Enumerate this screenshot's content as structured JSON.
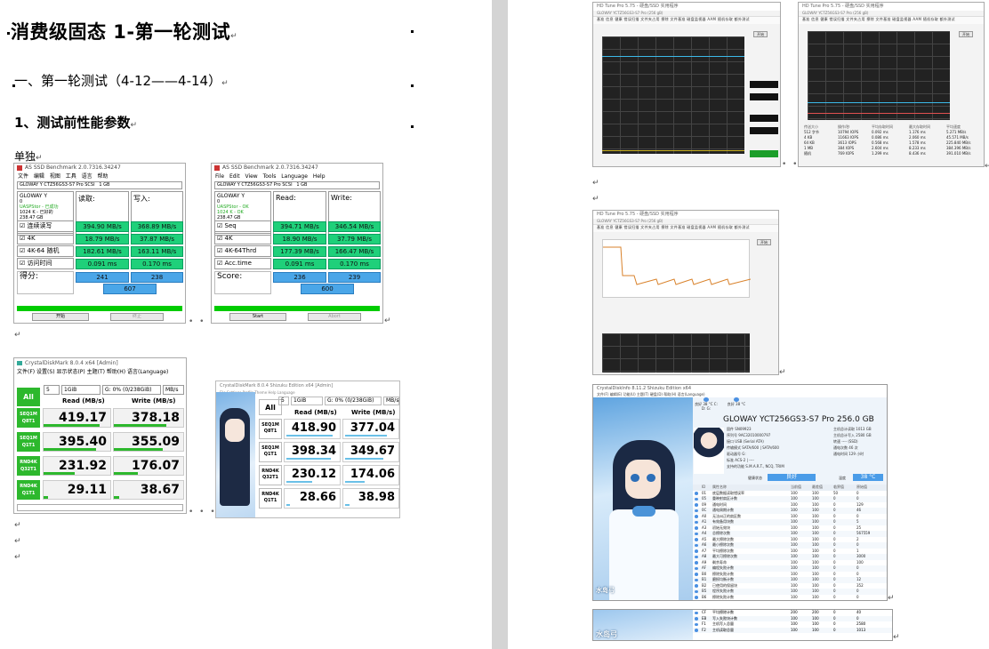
{
  "doc": {
    "title": "消费级固态 1-第一轮测试",
    "section": "一、第一轮测试（4-12——4-14）",
    "subsection": "1、测试前性能参数",
    "label_single": "单独",
    "para_mark": "↵"
  },
  "asssd_cn": {
    "titlebar": "AS SSD Benchmark 2.0.7316.34247",
    "menu": "文件  编辑  视图  工具  语言  帮助",
    "drive_select": "GLOWAY Y CTZ56GS3-S7 Pro SCSI",
    "size_select": "1 GB",
    "info": [
      "GLOWAY Y",
      "0",
      "UASPStor - 已成功",
      "1024 K - 已好的",
      "238.47 GB"
    ],
    "col_read": "读取:",
    "col_write": "写入:",
    "rows": [
      {
        "label": "连续读写",
        "read": "394.90 MB/s",
        "write": "368.89 MB/s"
      },
      {
        "label": "4K",
        "read": "18.79 MB/s",
        "write": "37.87 MB/s"
      },
      {
        "label": "4K-64 随机",
        "read": "182.61 MB/s",
        "write": "163.11 MB/s"
      },
      {
        "label": "访问时间",
        "read": "0.091 ms",
        "write": "0.170 ms"
      }
    ],
    "score_label": "得分:",
    "score_read": "241",
    "score_write": "238",
    "score_total": "607",
    "btn_start": "开始",
    "btn_abort": "终止"
  },
  "asssd_en": {
    "titlebar": "AS SSD Benchmark 2.0.7316.34247",
    "menu": "File  Edit  View  Tools  Language  Help",
    "drive_select": "GLOWAY Y CTZ56GS3-S7 Pro SCSI",
    "size_select": "1 GB",
    "info": [
      "GLOWAY Y",
      "0",
      "UASPStor - OK",
      "1024 K - OK",
      "238.47 GB"
    ],
    "col_read": "Read:",
    "col_write": "Write:",
    "rows": [
      {
        "label": "Seq",
        "read": "394.71 MB/s",
        "write": "346.54 MB/s"
      },
      {
        "label": "4K",
        "read": "18.90 MB/s",
        "write": "37.79 MB/s"
      },
      {
        "label": "4K-64Thrd",
        "read": "177.39 MB/s",
        "write": "166.47 MB/s"
      },
      {
        "label": "Acc.time",
        "read": "0.091 ms",
        "write": "0.170 ms"
      }
    ],
    "score_label": "Score:",
    "score_read": "236",
    "score_write": "239",
    "score_total": "600",
    "btn_start": "Start",
    "btn_abort": "Abort"
  },
  "cdm_cn": {
    "titlebar": "CrystalDiskMark 8.0.4 x64 [Admin]",
    "menu": "文件(F)  设置(S)  显示状态(P)  主题(T)  帮助(H)  语言(Language)",
    "all": "All",
    "count": "5",
    "size": "1GiB",
    "drive": "G: 0% (0/238GiB)",
    "unit": "MB/s",
    "head_read": "Read (MB/s)",
    "head_write": "Write (MB/s)",
    "rows": [
      {
        "l1": "SEQ1M",
        "l2": "Q8T1",
        "read": "419.17",
        "write": "378.18",
        "rf": 0.84,
        "wf": 0.76
      },
      {
        "l1": "SEQ1M",
        "l2": "Q1T1",
        "read": "395.40",
        "write": "355.09",
        "rf": 0.79,
        "wf": 0.71
      },
      {
        "l1": "RND4K",
        "l2": "Q32T1",
        "read": "231.92",
        "write": "176.07",
        "rf": 0.46,
        "wf": 0.35
      },
      {
        "l1": "RND4K",
        "l2": "Q1T1",
        "read": "29.11",
        "write": "38.67",
        "rf": 0.06,
        "wf": 0.08
      }
    ]
  },
  "cdm_shizuku": {
    "titlebar": "CrystalDiskMark 8.0.4 Shizuku Edition x64 [Admin]",
    "menu": "File  Settings  Profile  Theme  Help  Language",
    "all": "All",
    "count": "5",
    "size": "1GiB",
    "drive": "G: 0% (0/238GiB)",
    "unit": "MB/s",
    "head_read": "Read (MB/s)",
    "head_write": "Write (MB/s)",
    "rows": [
      {
        "l1": "SEQ1M",
        "l2": "Q8T1",
        "read": "418.90",
        "write": "377.04",
        "rf": 0.84,
        "wf": 0.75
      },
      {
        "l1": "SEQ1M",
        "l2": "Q1T1",
        "read": "398.34",
        "write": "349.67",
        "rf": 0.8,
        "wf": 0.7
      },
      {
        "l1": "RND4K",
        "l2": "Q32T1",
        "read": "230.12",
        "write": "174.06",
        "rf": 0.46,
        "wf": 0.35
      },
      {
        "l1": "RND4K",
        "l2": "Q1T1",
        "read": "28.66",
        "write": "38.98",
        "rf": 0.06,
        "wf": 0.08
      }
    ]
  },
  "hdtune": {
    "titlebar": "HD Tune Pro 5.75 - 硬盘/SSD 实用程序",
    "drive": "GLOWAY YCTZ56GS3-S7 Pro (256 gB)",
    "tabs": "基准  信息  健康  错误扫描  文件夹占用  擦除  文件基准  磁盘监视器  AAM  随机存取  额外测试",
    "start": "开始",
    "table_head": [
      "传送大小",
      "操作/秒",
      "平均存取时间",
      "最大存取时间",
      "平均速度"
    ],
    "table_rows": [
      [
        "512 字节",
        "10794 IOPS",
        "0.092 ms",
        "1.176 ms",
        "5.271 MB/s"
      ],
      [
        "4 KB",
        "11663 IOPS",
        "0.086 ms",
        "2.060 ms",
        "45.571 MB/s"
      ],
      [
        "64 KB",
        "3613 IOPS",
        "0.568 ms",
        "1.578 ms",
        "225.840 MB/s"
      ],
      [
        "1 MB",
        "384 IOPS",
        "2.604 ms",
        "8.233 ms",
        "384.396 MB/s"
      ],
      [
        "随机",
        "769 IOPS",
        "1.299 ms",
        "8.436 ms",
        "391.010 MB/s"
      ]
    ]
  },
  "cdi": {
    "titlebar": "CrystalDiskInfo 8.11.2 Shizuku Edition x64",
    "menu": "文件(F)  编辑(E)  功能(U)  主题(T)  硬盘(D)  帮助(H)  语言(Language)",
    "status1": "良好 38 °C C: D: G:",
    "status2": "良好 38 °C",
    "model": "GLOWAY YCT256GS3-S7 Pro 256.0 GB",
    "left_kv": [
      [
        "固件",
        "SN09923"
      ],
      [
        "序列号",
        "9AC32010000797"
      ],
      [
        "接口",
        "USB (Serial ATA)"
      ],
      [
        "传输模式",
        "SATA/600 | SATA/600"
      ],
      [
        "驱动器号",
        "G:"
      ],
      [
        "标准",
        "ACS-2 | ----"
      ],
      [
        "支持的功能",
        "S.M.A.R.T., NCQ, TRIM"
      ]
    ],
    "right_kv": [
      [
        "主机总计读取",
        "1013 GB"
      ],
      [
        "主机总计写入",
        "2580 GB"
      ],
      [
        "转速",
        "---- (SSD)"
      ],
      [
        "通电次数",
        "46 次"
      ],
      [
        "通电时间",
        "129 小时"
      ]
    ],
    "health_label": "健康状态",
    "health_value": "良好",
    "temp_label": "温度",
    "temp_value": "38 °C",
    "attr_head": [
      "ID",
      "属性名称",
      "当前值",
      "最差值",
      "临界值",
      "原始值"
    ],
    "attrs": [
      [
        "01",
        "底层数据读取错误率",
        "100",
        "100",
        "50",
        "0"
      ],
      [
        "05",
        "重映射扇区计数",
        "100",
        "100",
        "0",
        "0"
      ],
      [
        "09",
        "通电时间",
        "100",
        "100",
        "0",
        "129"
      ],
      [
        "0C",
        "通电周期计数",
        "100",
        "100",
        "0",
        "46"
      ],
      [
        "A0",
        "无法纠正的扇区数",
        "100",
        "100",
        "0",
        "0"
      ],
      [
        "A1",
        "有效备用块数",
        "100",
        "100",
        "0",
        "5"
      ],
      [
        "A3",
        "初始无效块",
        "100",
        "100",
        "0",
        "25"
      ],
      [
        "A4",
        "总擦除次数",
        "100",
        "100",
        "0",
        "567559"
      ],
      [
        "A5",
        "最大擦除次数",
        "100",
        "100",
        "0",
        "2"
      ],
      [
        "A6",
        "最小擦除次数",
        "100",
        "100",
        "0",
        "0"
      ],
      [
        "A7",
        "平均擦除次数",
        "100",
        "100",
        "0",
        "1"
      ],
      [
        "A8",
        "最大可擦除次数",
        "100",
        "100",
        "0",
        "3000"
      ],
      [
        "A9",
        "剩余寿命",
        "100",
        "100",
        "0",
        "100"
      ],
      [
        "AF",
        "编程失败计数",
        "100",
        "100",
        "0",
        "0"
      ],
      [
        "B0",
        "擦除失败计数",
        "100",
        "100",
        "0",
        "0"
      ],
      [
        "B1",
        "磨损均衡计数",
        "100",
        "100",
        "0",
        "12"
      ],
      [
        "B2",
        "已使用的保留块",
        "100",
        "100",
        "0",
        "352"
      ],
      [
        "B5",
        "程序失败计数",
        "100",
        "100",
        "0",
        "0"
      ],
      [
        "B6",
        "擦除失败计数",
        "100",
        "100",
        "0",
        "0"
      ],
      [
        "C0",
        "意外断电计数",
        "100",
        "100",
        "0",
        "9"
      ],
      [
        "C2",
        "温度",
        "38",
        "38",
        "0",
        "150327513228"
      ],
      [
        "C3",
        "硬件 ECC 恢复",
        "100",
        "100",
        "0",
        "0"
      ],
      [
        "C4",
        "重映射事件计数",
        "100",
        "100",
        "0",
        "0"
      ],
      [
        "C5",
        "当前待映射扇区数",
        "100",
        "100",
        "0",
        "0"
      ],
      [
        "C6",
        "无法校正的扇区数",
        "100",
        "100",
        "0",
        "0"
      ],
      [
        "C7",
        "UltraDMA CRC 错误计数",
        "100",
        "100",
        "0",
        "0"
      ],
      [
        "CE",
        "写入错误率",
        "100",
        "100",
        "0",
        "0"
      ],
      [
        "E8",
        "可用保留空间",
        "100",
        "100",
        "0",
        "100"
      ],
      [
        "F1",
        "主机写入总量",
        "100",
        "100",
        "0",
        "2580"
      ],
      [
        "F2",
        "主机读取总量",
        "100",
        "100",
        "0",
        "1013"
      ]
    ],
    "sig": "水岛弓",
    "attrs2": [
      [
        "CF",
        "平均擦除计数",
        "200",
        "200",
        "0",
        "40"
      ],
      [
        "EB",
        "写入失败块计数",
        "100",
        "100",
        "0",
        "0"
      ],
      [
        "F1",
        "主机写入总量",
        "100",
        "100",
        "0",
        "2580"
      ],
      [
        "F2",
        "主机读取总量",
        "100",
        "100",
        "0",
        "1013"
      ]
    ]
  }
}
